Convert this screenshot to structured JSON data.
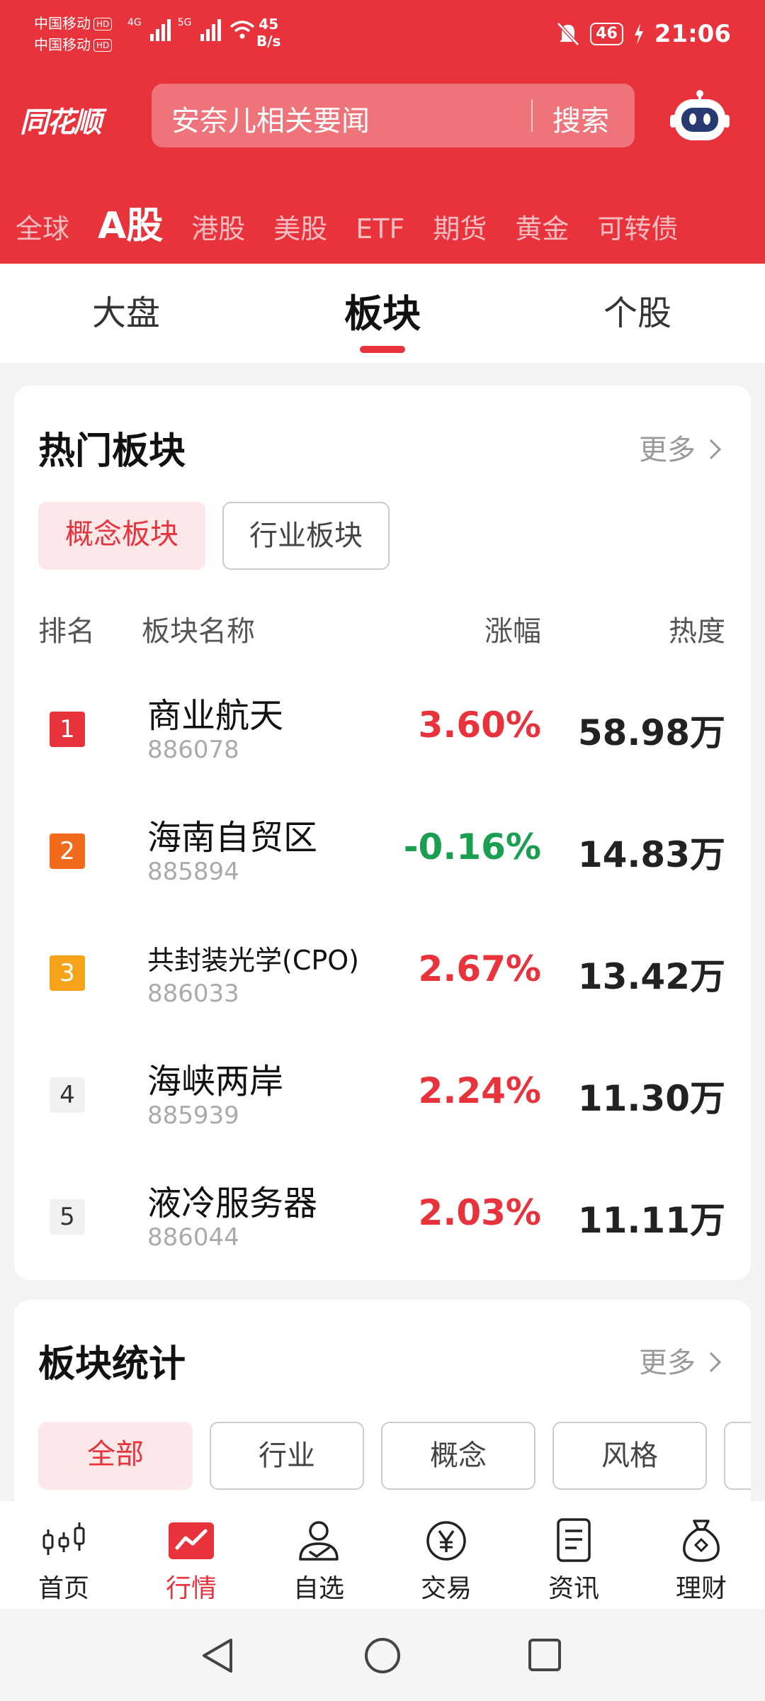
{
  "status_bar": {
    "carrier1": "中国移动",
    "carrier2": "中国移动",
    "hd": "HD",
    "sig1": "4G",
    "sig2": "5G",
    "speed_value": "45",
    "speed_unit": "B/s",
    "battery": "46",
    "time": "21:06"
  },
  "header": {
    "logo": "同花顺",
    "search_placeholder": "安奈儿相关要闻",
    "search_button": "搜索"
  },
  "market_tabs": [
    "全球",
    "A股",
    "港股",
    "美股",
    "ETF",
    "期货",
    "黄金",
    "可转债"
  ],
  "sub_tabs": {
    "t1": "大盘",
    "t2": "板块",
    "t3": "个股"
  },
  "hot_sectors": {
    "title": "热门板块",
    "more": "更多",
    "seg_concept": "概念板块",
    "seg_industry": "行业板块",
    "col_rank": "排名",
    "col_name": "板块名称",
    "col_change": "涨幅",
    "col_heat": "热度",
    "rows": [
      {
        "rank": "1",
        "name": "商业航天",
        "code": "886078",
        "change": "3.60%",
        "heat": "58.98万"
      },
      {
        "rank": "2",
        "name": "海南自贸区",
        "code": "885894",
        "change": "-0.16%",
        "heat": "14.83万"
      },
      {
        "rank": "3",
        "name": "共封装光学(CPO)",
        "code": "886033",
        "change": "2.67%",
        "heat": "13.42万"
      },
      {
        "rank": "4",
        "name": "海峡两岸",
        "code": "885939",
        "change": "2.24%",
        "heat": "11.30万"
      },
      {
        "rank": "5",
        "name": "液冷服务器",
        "code": "886044",
        "change": "2.03%",
        "heat": "11.11万"
      }
    ]
  },
  "sector_stats": {
    "title": "板块统计",
    "more": "更多",
    "filters": [
      "全部",
      "行业",
      "概念",
      "风格"
    ]
  },
  "bottom_nav": [
    "首页",
    "行情",
    "自选",
    "交易",
    "资讯",
    "理财"
  ],
  "colors": {
    "brand": "#e8323c",
    "up": "#e8323c",
    "down": "#1a9e4f"
  }
}
